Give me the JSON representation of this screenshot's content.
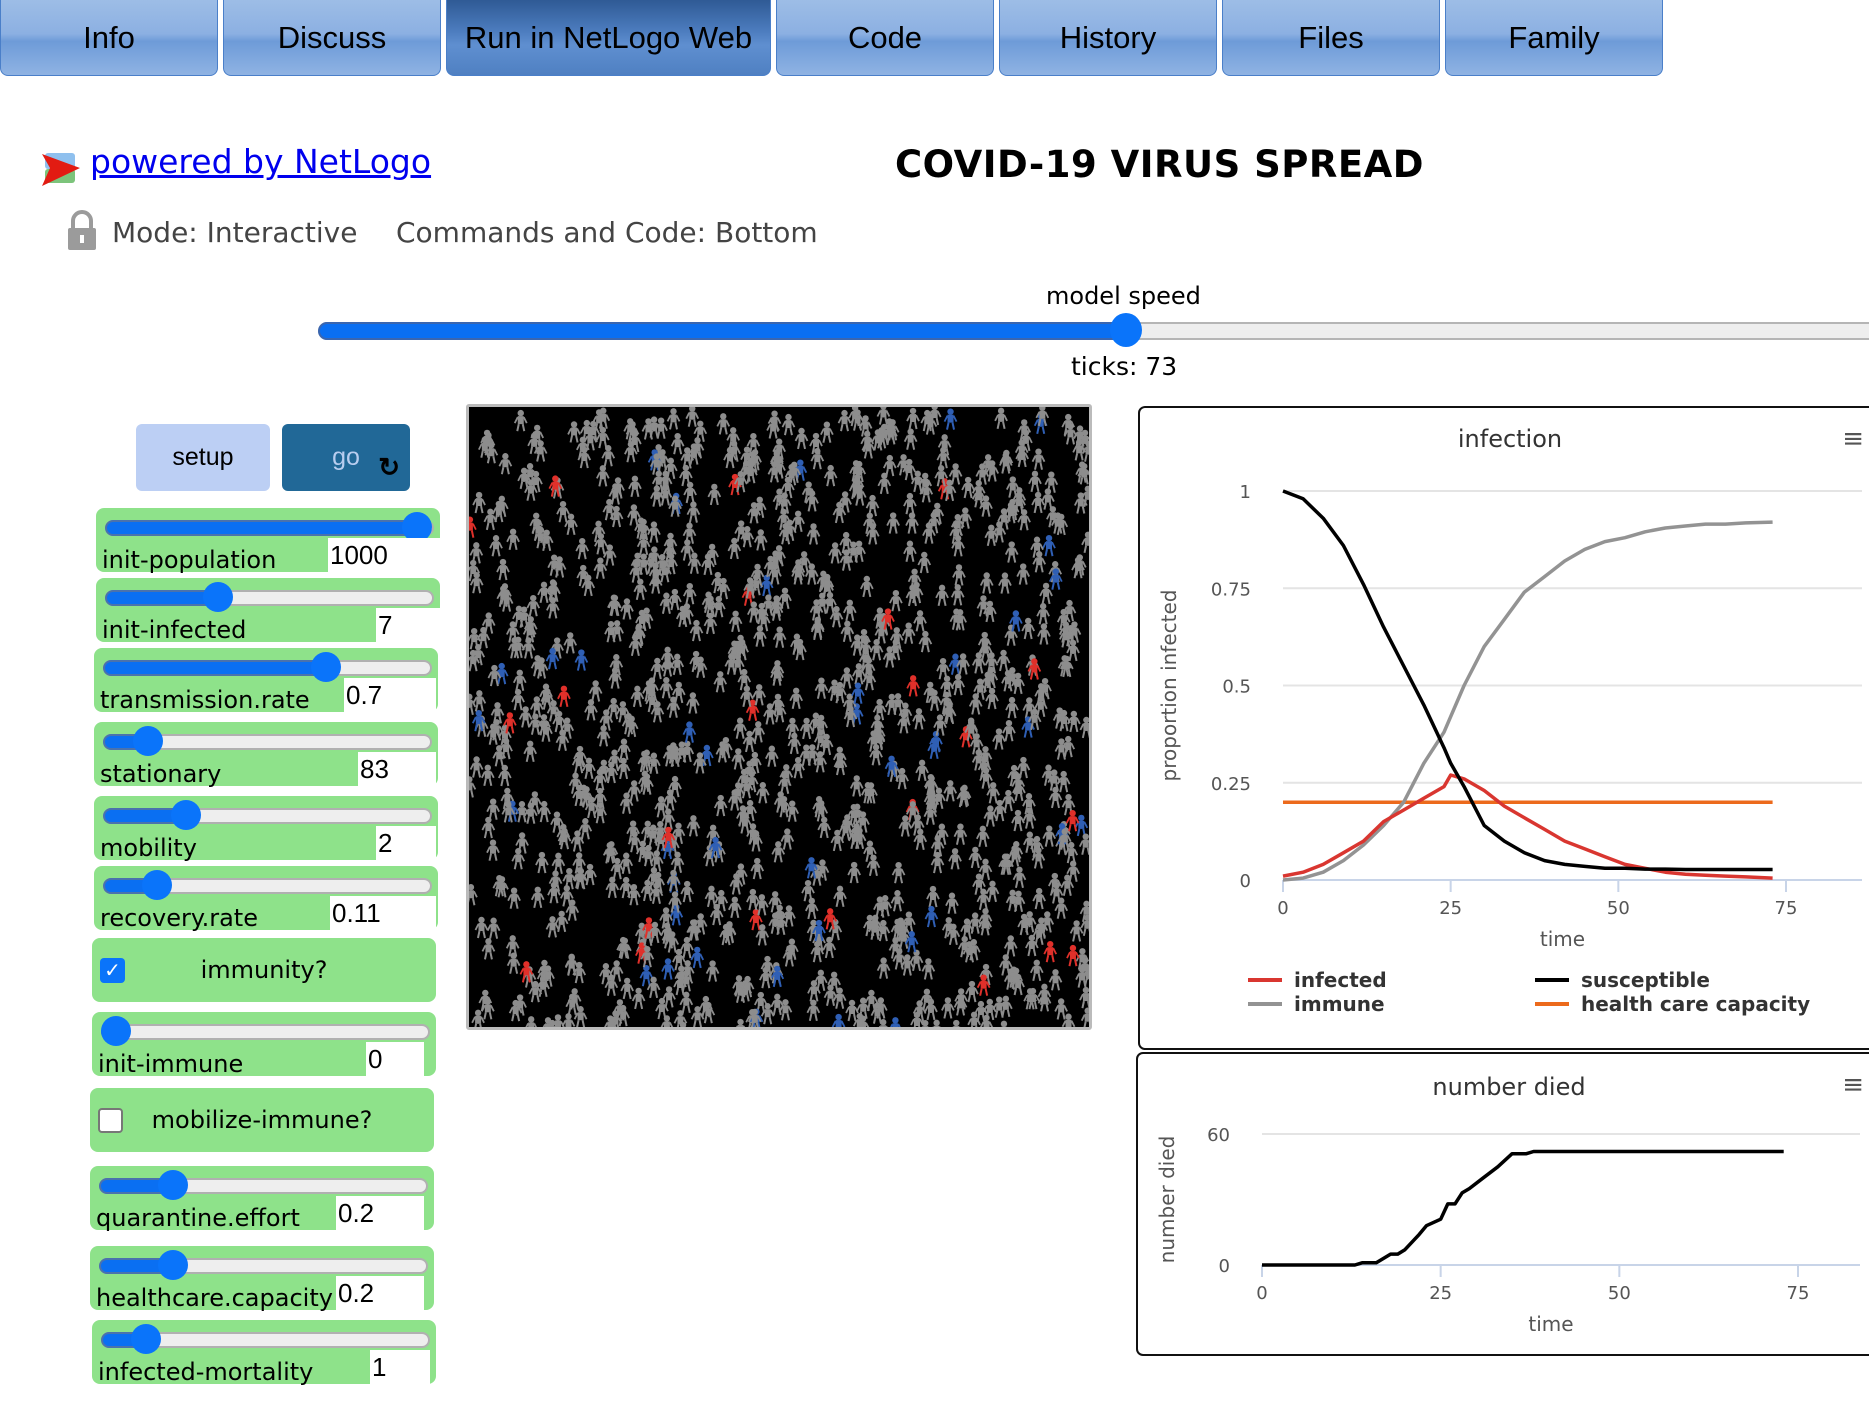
{
  "tabs": [
    {
      "label": "Info",
      "active": false
    },
    {
      "label": "Discuss",
      "active": false
    },
    {
      "label": "Run in NetLogo Web",
      "active": true
    },
    {
      "label": "Code",
      "active": false
    },
    {
      "label": "History",
      "active": false
    },
    {
      "label": "Files",
      "active": false
    },
    {
      "label": "Family",
      "active": false
    }
  ],
  "header": {
    "powered_by": " powered by NetLogo",
    "model_title": "COVID-19 VIRUS SPREAD",
    "mode": "Mode: Interactive",
    "commands_position": "Commands and Code: Bottom"
  },
  "speed": {
    "label": "model speed",
    "value_fraction": 0.5,
    "ticks_text": "ticks: 73"
  },
  "buttons": {
    "setup": "setup",
    "go": "go",
    "go_icon": "forever-icon"
  },
  "sliders": [
    {
      "name": "init-population",
      "value": "1000",
      "fraction": 1.0
    },
    {
      "name": "init-infected",
      "value": "7",
      "fraction": 0.33
    },
    {
      "name": "transmission.rate",
      "value": "0.7",
      "fraction": 0.7
    },
    {
      "name": "stationary",
      "value": "83",
      "fraction": 0.1
    },
    {
      "name": "mobility",
      "value": "2",
      "fraction": 0.23
    },
    {
      "name": "recovery.rate",
      "value": "0.11",
      "fraction": 0.13
    },
    {
      "name": "init-immune",
      "value": "0",
      "fraction": 0.0
    },
    {
      "name": "quarantine.effort",
      "value": "0.2",
      "fraction": 0.2
    },
    {
      "name": "healthcare.capacity",
      "value": "0.2",
      "fraction": 0.2
    },
    {
      "name": "infected-mortality",
      "value": "1",
      "fraction": 0.1
    }
  ],
  "switches": [
    {
      "name": "immunity?",
      "on": true
    },
    {
      "name": "mobilize-immune?",
      "on": false
    }
  ],
  "world": {
    "colors": {
      "susceptible": "#8d8d8d",
      "infected": "#e0302a",
      "immune": "#2f5fb5",
      "background": "#000000"
    }
  },
  "chart_data": [
    {
      "type": "line",
      "title": "infection",
      "xlabel": "time",
      "ylabel": "proportion infected",
      "xlim": [
        0,
        75
      ],
      "ylim": [
        0,
        1
      ],
      "xticks": [
        "0",
        "25",
        "50",
        "75"
      ],
      "yticks": [
        "0",
        "0.25",
        "0.5",
        "0.75",
        "1"
      ],
      "grid": true,
      "legend_position": "bottom",
      "x": [
        0,
        3,
        6,
        9,
        12,
        15,
        18,
        21,
        24,
        25,
        27,
        30,
        33,
        36,
        39,
        42,
        45,
        48,
        51,
        54,
        57,
        60,
        63,
        66,
        69,
        73
      ],
      "series": [
        {
          "name": "infected",
          "color": "#d93630",
          "values": [
            0.01,
            0.02,
            0.04,
            0.07,
            0.1,
            0.15,
            0.18,
            0.21,
            0.24,
            0.27,
            0.26,
            0.23,
            0.19,
            0.16,
            0.13,
            0.1,
            0.08,
            0.06,
            0.04,
            0.03,
            0.02,
            0.015,
            0.012,
            0.01,
            0.008,
            0.005
          ]
        },
        {
          "name": "susceptible",
          "color": "#000000",
          "values": [
            1.0,
            0.98,
            0.93,
            0.86,
            0.76,
            0.65,
            0.55,
            0.45,
            0.34,
            0.3,
            0.24,
            0.14,
            0.1,
            0.07,
            0.05,
            0.04,
            0.035,
            0.03,
            0.03,
            0.028,
            0.028,
            0.027,
            0.027,
            0.027,
            0.027,
            0.027
          ]
        },
        {
          "name": "immune",
          "color": "#939393",
          "values": [
            0.0,
            0.005,
            0.02,
            0.05,
            0.09,
            0.14,
            0.2,
            0.3,
            0.38,
            0.42,
            0.5,
            0.6,
            0.67,
            0.74,
            0.78,
            0.82,
            0.85,
            0.87,
            0.88,
            0.895,
            0.905,
            0.91,
            0.915,
            0.915,
            0.918,
            0.92
          ]
        },
        {
          "name": "health care capacity",
          "color": "#ec6a1c",
          "values": [
            0.2,
            0.2,
            0.2,
            0.2,
            0.2,
            0.2,
            0.2,
            0.2,
            0.2,
            0.2,
            0.2,
            0.2,
            0.2,
            0.2,
            0.2,
            0.2,
            0.2,
            0.2,
            0.2,
            0.2,
            0.2,
            0.2,
            0.2,
            0.2,
            0.2,
            0.2
          ]
        }
      ],
      "legend": [
        {
          "label": "infected",
          "color": "#d93630"
        },
        {
          "label": "susceptible",
          "color": "#000000"
        },
        {
          "label": "immune",
          "color": "#939393"
        },
        {
          "label": "health care capacity",
          "color": "#ec6a1c"
        }
      ]
    },
    {
      "type": "line",
      "title": "number died",
      "xlabel": "time",
      "ylabel": "number died",
      "xlim": [
        0,
        75
      ],
      "ylim": [
        0,
        60
      ],
      "xticks": [
        "0",
        "25",
        "50",
        "75"
      ],
      "yticks": [
        "0",
        "60"
      ],
      "grid": true,
      "x": [
        0,
        10,
        13,
        14,
        16,
        18,
        19,
        20,
        22,
        23,
        25,
        26,
        27,
        28,
        29,
        31,
        33,
        35,
        37,
        38,
        73
      ],
      "series": [
        {
          "name": "number died",
          "color": "#000000",
          "values": [
            0,
            0,
            0,
            1,
            1,
            5,
            5,
            7,
            14,
            18,
            21,
            28,
            28,
            33,
            35,
            40,
            45,
            51,
            51,
            52,
            52
          ]
        }
      ]
    }
  ]
}
